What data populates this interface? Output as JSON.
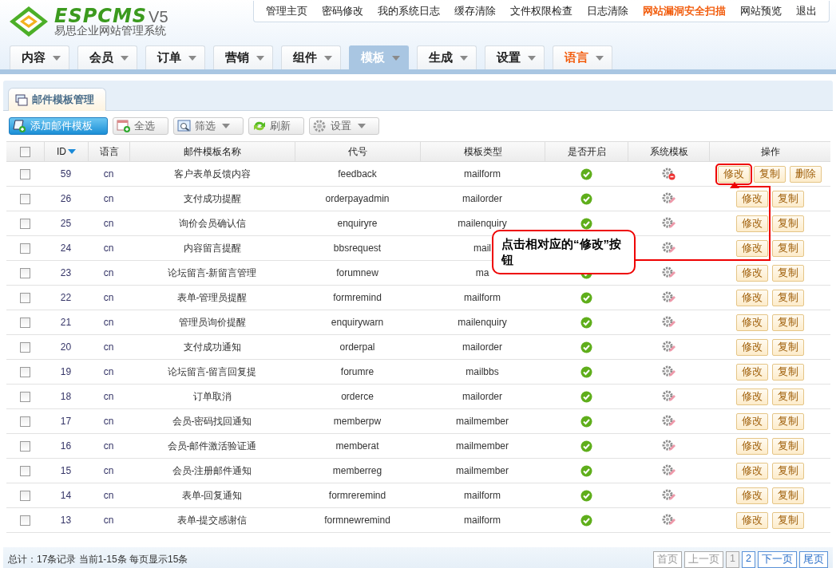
{
  "logo": {
    "name": "ESPCMS",
    "version": "V5",
    "subtitle": "易思企业网站管理系统"
  },
  "top_links": [
    {
      "label": "管理主页",
      "highlight": false
    },
    {
      "label": "密码修改",
      "highlight": false
    },
    {
      "label": "我的系统日志",
      "highlight": false
    },
    {
      "label": "缓存清除",
      "highlight": false
    },
    {
      "label": "文件权限检查",
      "highlight": false
    },
    {
      "label": "日志清除",
      "highlight": false
    },
    {
      "label": "网站漏洞安全扫描",
      "highlight": true
    },
    {
      "label": "网站预览",
      "highlight": false
    },
    {
      "label": "退出",
      "highlight": false
    }
  ],
  "nav_tabs": [
    {
      "label": "内容",
      "selected": false,
      "highlight": false
    },
    {
      "label": "会员",
      "selected": false,
      "highlight": false
    },
    {
      "label": "订单",
      "selected": false,
      "highlight": false
    },
    {
      "label": "营销",
      "selected": false,
      "highlight": false
    },
    {
      "label": "组件",
      "selected": false,
      "highlight": false
    },
    {
      "label": "模板",
      "selected": true,
      "highlight": false
    },
    {
      "label": "生成",
      "selected": false,
      "highlight": false
    },
    {
      "label": "设置",
      "selected": false,
      "highlight": false
    },
    {
      "label": "语言",
      "selected": false,
      "highlight": true
    }
  ],
  "panel_tab": {
    "label": "邮件模板管理"
  },
  "toolbar": [
    {
      "label": "添加邮件模板",
      "kind": "primary",
      "dropdown": false
    },
    {
      "label": "全选",
      "kind": "select-all",
      "dropdown": false
    },
    {
      "label": "筛选",
      "kind": "filter",
      "dropdown": true
    },
    {
      "label": "刷新",
      "kind": "refresh",
      "dropdown": false
    },
    {
      "label": "设置",
      "kind": "settings",
      "dropdown": true
    }
  ],
  "table": {
    "header_checked": false,
    "columns": [
      "ID",
      "语言",
      "邮件模板名称",
      "代号",
      "模板类型",
      "是否开启",
      "系统模板",
      "操作"
    ],
    "rows": [
      {
        "checked": false,
        "id": "59",
        "lang": "cn",
        "name": "客户表单反馈内容",
        "code": "feedback",
        "type": "mailform",
        "enabled": true,
        "locked": true,
        "actions": [
          {
            "label": "修改",
            "highlighted": true
          },
          {
            "label": "复制",
            "highlighted": false
          },
          {
            "label": "删除",
            "highlighted": false
          }
        ]
      },
      {
        "checked": false,
        "id": "26",
        "lang": "cn",
        "name": "支付成功提醒",
        "code": "orderpayadmin",
        "type": "mailorder",
        "enabled": true,
        "locked": false,
        "actions": [
          {
            "label": "修改",
            "highlighted": false
          },
          {
            "label": "复制",
            "highlighted": false
          }
        ]
      },
      {
        "checked": false,
        "id": "25",
        "lang": "cn",
        "name": "询价会员确认信",
        "code": "enquiryre",
        "type": "mailenquiry",
        "enabled": true,
        "locked": false,
        "actions": [
          {
            "label": "修改",
            "highlighted": false
          },
          {
            "label": "复制",
            "highlighted": false
          }
        ]
      },
      {
        "checked": false,
        "id": "24",
        "lang": "cn",
        "name": "内容留言提醒",
        "code": "bbsrequest",
        "type": "mail",
        "locked": false,
        "actions": [
          {
            "label": "修改",
            "highlighted": false
          },
          {
            "label": "复制",
            "highlighted": false
          }
        ]
      },
      {
        "checked": false,
        "id": "23",
        "lang": "cn",
        "name": "论坛留言-新留言管理",
        "code": "forumnew",
        "type": "ma",
        "enabled": true,
        "locked": false,
        "actions": [
          {
            "label": "修改",
            "highlighted": false
          },
          {
            "label": "复制",
            "highlighted": false
          }
        ]
      },
      {
        "checked": false,
        "id": "22",
        "lang": "cn",
        "name": "表单-管理员提醒",
        "code": "formremind",
        "type": "mailform",
        "enabled": true,
        "locked": false,
        "actions": [
          {
            "label": "修改",
            "highlighted": false
          },
          {
            "label": "复制",
            "highlighted": false
          }
        ]
      },
      {
        "checked": false,
        "id": "21",
        "lang": "cn",
        "name": "管理员询价提醒",
        "code": "enquirywarn",
        "type": "mailenquiry",
        "enabled": true,
        "locked": false,
        "actions": [
          {
            "label": "修改",
            "highlighted": false
          },
          {
            "label": "复制",
            "highlighted": false
          }
        ]
      },
      {
        "checked": false,
        "id": "20",
        "lang": "cn",
        "name": "支付成功通知",
        "code": "orderpal",
        "type": "mailorder",
        "enabled": true,
        "locked": false,
        "actions": [
          {
            "label": "修改",
            "highlighted": false
          },
          {
            "label": "复制",
            "highlighted": false
          }
        ]
      },
      {
        "checked": false,
        "id": "19",
        "lang": "cn",
        "name": "论坛留言-留言回复提",
        "code": "forumre",
        "type": "mailbbs",
        "enabled": true,
        "locked": false,
        "actions": [
          {
            "label": "修改",
            "highlighted": false
          },
          {
            "label": "复制",
            "highlighted": false
          }
        ]
      },
      {
        "checked": false,
        "id": "18",
        "lang": "cn",
        "name": "订单取消",
        "code": "orderce",
        "type": "mailorder",
        "enabled": true,
        "locked": false,
        "actions": [
          {
            "label": "修改",
            "highlighted": false
          },
          {
            "label": "复制",
            "highlighted": false
          }
        ]
      },
      {
        "checked": false,
        "id": "17",
        "lang": "cn",
        "name": "会员-密码找回通知",
        "code": "memberpw",
        "type": "mailmember",
        "enabled": true,
        "locked": false,
        "actions": [
          {
            "label": "修改",
            "highlighted": false
          },
          {
            "label": "复制",
            "highlighted": false
          }
        ]
      },
      {
        "checked": false,
        "id": "16",
        "lang": "cn",
        "name": "会员-邮件激活验证通",
        "code": "memberat",
        "type": "mailmember",
        "enabled": true,
        "locked": false,
        "actions": [
          {
            "label": "修改",
            "highlighted": false
          },
          {
            "label": "复制",
            "highlighted": false
          }
        ]
      },
      {
        "checked": false,
        "id": "15",
        "lang": "cn",
        "name": "会员-注册邮件通知",
        "code": "memberreg",
        "type": "mailmember",
        "enabled": true,
        "locked": false,
        "actions": [
          {
            "label": "修改",
            "highlighted": false
          },
          {
            "label": "复制",
            "highlighted": false
          }
        ]
      },
      {
        "checked": false,
        "id": "14",
        "lang": "cn",
        "name": "表单-回复通知",
        "code": "formreremind",
        "type": "mailform",
        "enabled": true,
        "locked": false,
        "actions": [
          {
            "label": "修改",
            "highlighted": false
          },
          {
            "label": "复制",
            "highlighted": false
          }
        ]
      },
      {
        "checked": false,
        "id": "13",
        "lang": "cn",
        "name": "表单-提交感谢信",
        "code": "formnewremind",
        "type": "mailform",
        "enabled": true,
        "locked": false,
        "actions": [
          {
            "label": "修改",
            "highlighted": false
          },
          {
            "label": "复制",
            "highlighted": false
          }
        ]
      }
    ]
  },
  "footer": {
    "summary": "总计：17条记录 当前1-15条 每页显示15条",
    "pagination": [
      {
        "label": "首页",
        "disabled": true,
        "selected": false
      },
      {
        "label": "上一页",
        "disabled": true,
        "selected": false
      },
      {
        "label": "1",
        "disabled": false,
        "selected": true
      },
      {
        "label": "2",
        "disabled": false,
        "selected": false
      },
      {
        "label": "下一页",
        "disabled": false,
        "selected": false
      },
      {
        "label": "尾页",
        "disabled": false,
        "selected": false
      }
    ]
  },
  "annotation": {
    "text": "点击相对应的“修改”按钮"
  }
}
